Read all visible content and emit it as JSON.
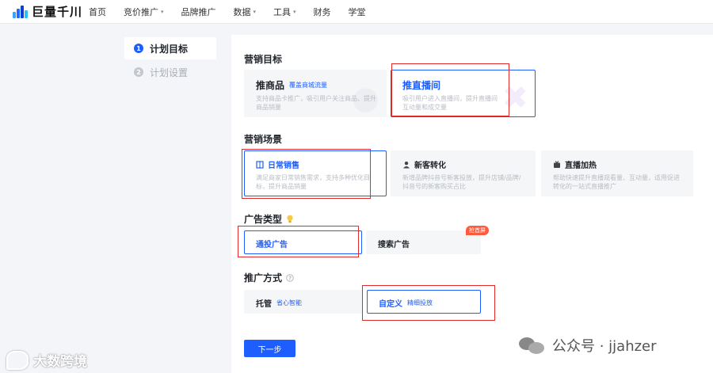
{
  "nav": {
    "brand": "巨量千川",
    "items": [
      {
        "label": "首页",
        "dropdown": false
      },
      {
        "label": "竞价推广",
        "dropdown": true
      },
      {
        "label": "品牌推广",
        "dropdown": false
      },
      {
        "label": "数据",
        "dropdown": true
      },
      {
        "label": "工具",
        "dropdown": true
      },
      {
        "label": "财务",
        "dropdown": false
      },
      {
        "label": "学堂",
        "dropdown": false
      }
    ],
    "caret": "▾"
  },
  "steps": [
    {
      "num": "1",
      "label": "计划目标",
      "active": true
    },
    {
      "num": "2",
      "label": "计划设置",
      "active": false
    }
  ],
  "marketing_goal": {
    "title": "营销目标",
    "options": [
      {
        "title": "推商品",
        "tag": "覆盖商城流量",
        "desc": "支持商品卡推广，吸引用户关注商品、提升商品销量",
        "selected": false
      },
      {
        "title": "推直播间",
        "tag": "",
        "desc": "吸引用户进入直播间，提升直播间互动量和成交量",
        "selected": true
      }
    ]
  },
  "scene": {
    "title": "营销场景",
    "options": [
      {
        "title": "日常销售",
        "icon": "book-icon",
        "desc": "满足商家日常销售需求，支持多种优化目标，提升商品销量",
        "selected": true
      },
      {
        "title": "新客转化",
        "icon": "user-icon",
        "desc": "新增品牌抖音号新客投放，提升店铺/品牌/抖音号的新客购买占比",
        "selected": false
      },
      {
        "title": "直播加热",
        "icon": "tv-icon",
        "desc": "帮助快速提升直播观看量、互动量，适用促进转化的一站式直播推广",
        "selected": false
      }
    ]
  },
  "ad_type": {
    "title": "广告类型",
    "icon": "bulb-icon",
    "options": [
      {
        "title": "通投广告",
        "selected": true,
        "badge": ""
      },
      {
        "title": "搜索广告",
        "selected": false,
        "badge": "抢首屏"
      }
    ]
  },
  "promo_method": {
    "title": "推广方式",
    "icon": "help-icon",
    "options": [
      {
        "title": "托管",
        "tag": "省心智能",
        "selected": false
      },
      {
        "title": "自定义",
        "tag": "精细投放",
        "selected": true
      }
    ]
  },
  "next_button": "下一步",
  "watermarks": {
    "left": "大数跨境",
    "right": "公众号 · jjahzer"
  },
  "colors": {
    "accent": "#1e5eff",
    "annotation": "#e02b2b",
    "hot_badge": "#ff5a3c"
  }
}
